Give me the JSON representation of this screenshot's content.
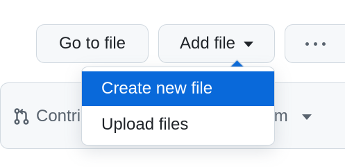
{
  "toolbar": {
    "goto_file_label": "Go to file",
    "add_file_label": "Add file",
    "more_icon": "kebab-horizontal-icon"
  },
  "dropdown": {
    "items": [
      {
        "label": "Create new file",
        "highlighted": true
      },
      {
        "label": "Upload files",
        "highlighted": false
      }
    ]
  },
  "background_bar": {
    "contribute_label_visible": "Contri",
    "contribute_icon": "git-pull-request-icon",
    "right_label_visible": "eam"
  },
  "colors": {
    "accent": "#0969da",
    "button_bg": "#f6f8fa",
    "border": "#d1d9e0",
    "text": "#1f2328",
    "muted": "#59636e"
  }
}
